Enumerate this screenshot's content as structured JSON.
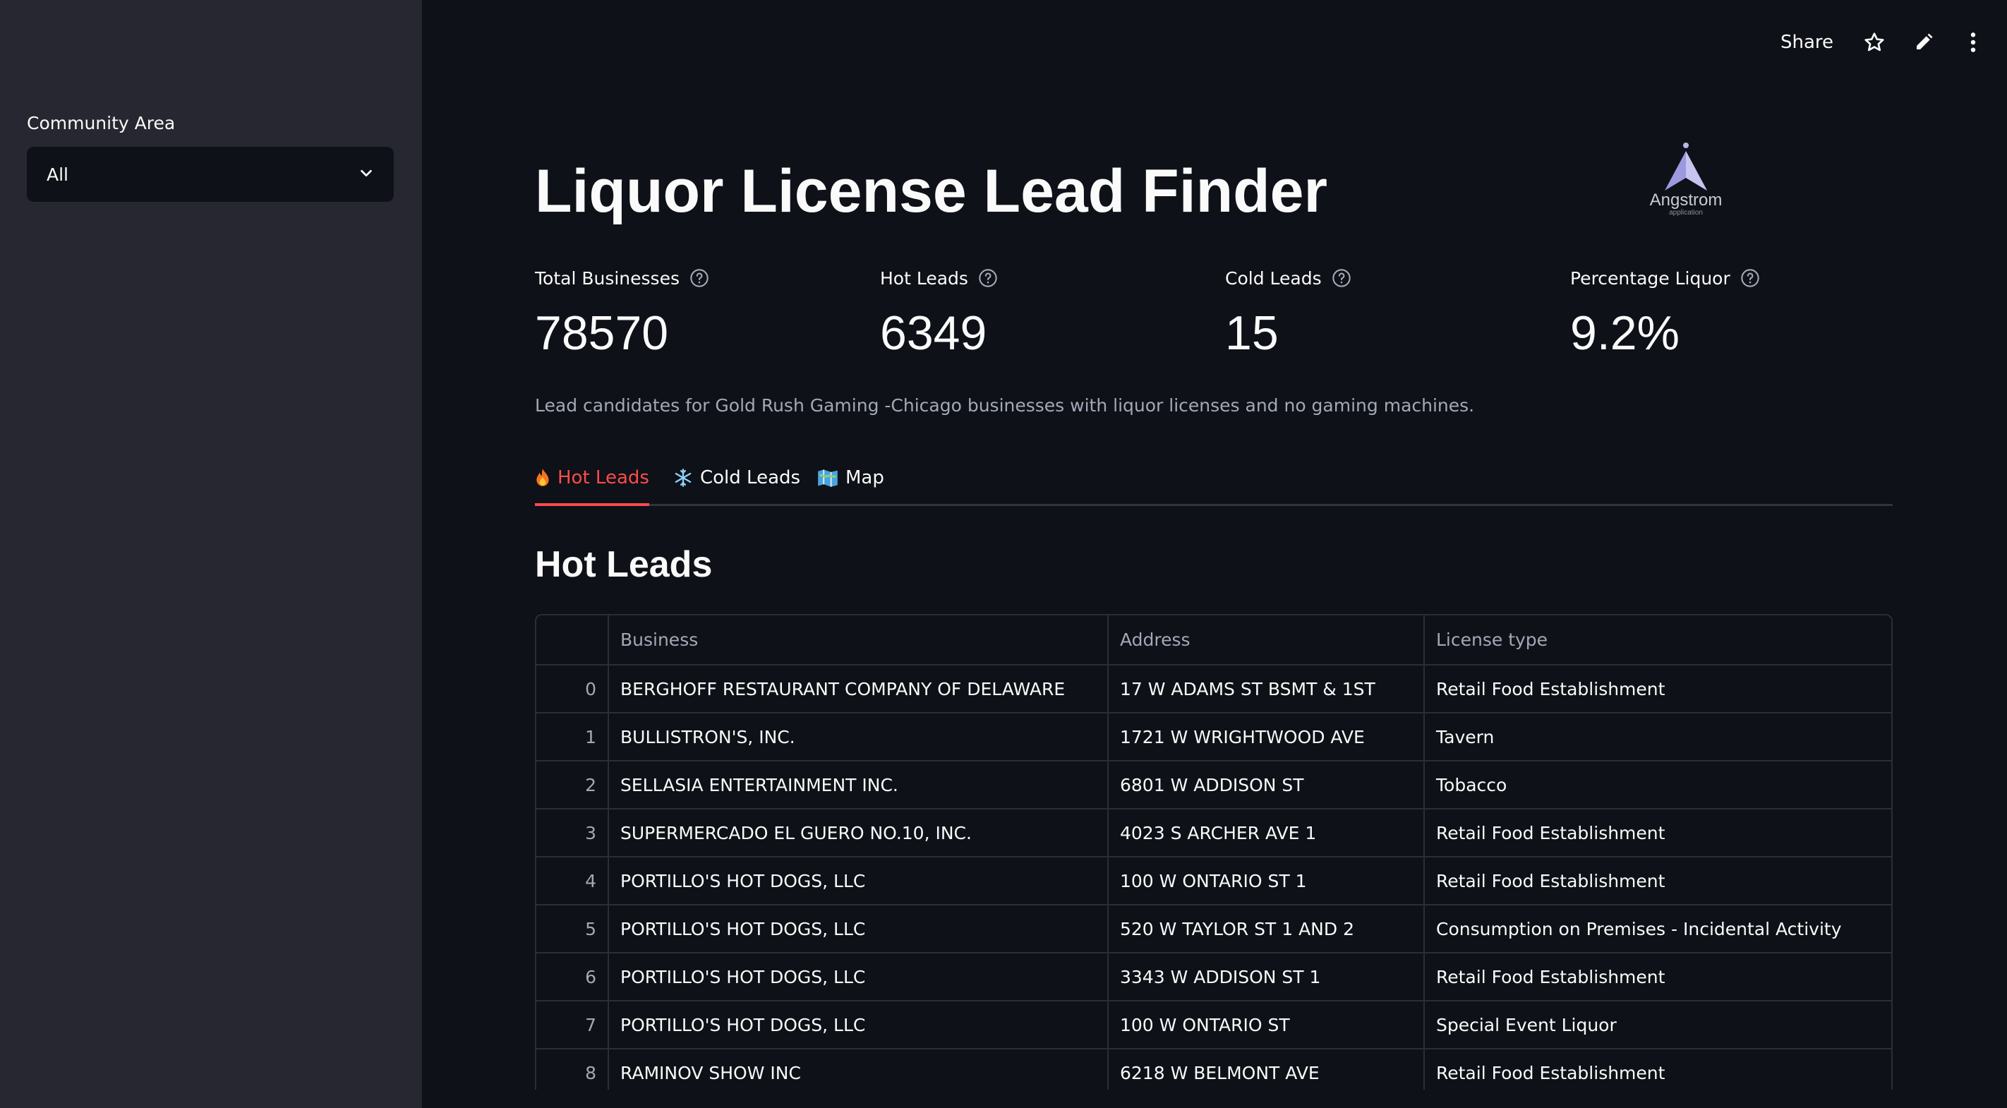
{
  "sidebar": {
    "filter_label": "Community Area",
    "filter_value": "All"
  },
  "toolbar": {
    "share_label": "Share"
  },
  "header": {
    "title": "Liquor License Lead Finder",
    "logo_name": "Angstrom",
    "logo_sub": "application"
  },
  "metrics": [
    {
      "label": "Total Businesses",
      "value": "78570"
    },
    {
      "label": "Hot Leads",
      "value": "6349"
    },
    {
      "label": "Cold Leads",
      "value": "15"
    },
    {
      "label": "Percentage Liquor",
      "value": "9.2%"
    }
  ],
  "caption": "Lead candidates for Gold Rush Gaming -Chicago businesses with liquor licenses and no gaming machines.",
  "tabs": [
    {
      "label": "Hot Leads",
      "icon": "fire-icon",
      "active": true
    },
    {
      "label": "Cold Leads",
      "icon": "snowflake-icon",
      "active": false
    },
    {
      "label": "Map",
      "icon": "map-icon",
      "active": false
    }
  ],
  "section_title": "Hot Leads",
  "table": {
    "columns": [
      "",
      "Business",
      "Address",
      "License type"
    ],
    "rows": [
      [
        "0",
        "BERGHOFF RESTAURANT COMPANY OF DELAWARE",
        "17 W ADAMS ST BSMT & 1ST",
        "Retail Food Establishment"
      ],
      [
        "1",
        "BULLISTRON'S, INC.",
        "1721 W WRIGHTWOOD AVE",
        "Tavern"
      ],
      [
        "2",
        "SELLASIA ENTERTAINMENT INC.",
        "6801 W ADDISON ST",
        "Tobacco"
      ],
      [
        "3",
        "SUPERMERCADO EL GUERO NO.10, INC.",
        "4023 S ARCHER AVE 1",
        "Retail Food Establishment"
      ],
      [
        "4",
        "PORTILLO'S HOT DOGS, LLC",
        "100 W ONTARIO ST 1",
        "Retail Food Establishment"
      ],
      [
        "5",
        "PORTILLO'S HOT DOGS, LLC",
        "520 W TAYLOR ST 1 AND 2",
        "Consumption on Premises - Incidental Activity"
      ],
      [
        "6",
        "PORTILLO'S HOT DOGS, LLC",
        "3343 W ADDISON ST 1",
        "Retail Food Establishment"
      ],
      [
        "7",
        "PORTILLO'S HOT DOGS, LLC",
        "100 W ONTARIO ST",
        "Special Event Liquor"
      ],
      [
        "8",
        "RAMINOV SHOW INC",
        "6218 W BELMONT AVE",
        "Retail Food Establishment"
      ]
    ]
  },
  "colors": {
    "background": "#0e1117",
    "sidebar": "#262730",
    "accent": "#ff4b4b",
    "muted_text": "#a3a8b8"
  }
}
